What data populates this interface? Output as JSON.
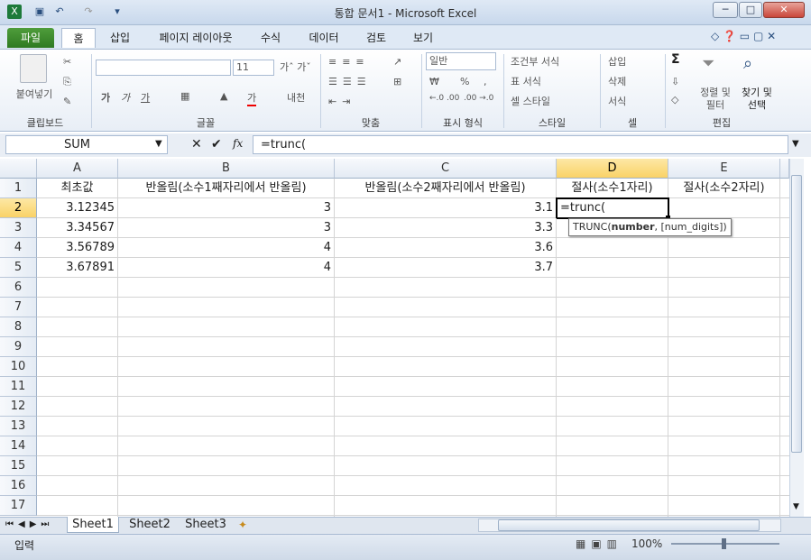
{
  "window": {
    "title": "통합 문서1 - Microsoft Excel",
    "minimize": "─",
    "maximize": "□",
    "close": "✕"
  },
  "quick_access": {
    "save_icon": "save-icon",
    "undo_icon": "undo-icon",
    "redo_icon": "redo-icon"
  },
  "tabs": [
    {
      "label": "파일"
    },
    {
      "label": "홈"
    },
    {
      "label": "삽입"
    },
    {
      "label": "페이지 레이아웃"
    },
    {
      "label": "수식"
    },
    {
      "label": "데이터"
    },
    {
      "label": "검토"
    },
    {
      "label": "보기"
    }
  ],
  "ribbon": {
    "clipboard": {
      "group_label": "클립보드",
      "paste_label": "붙여넣기"
    },
    "font": {
      "group_label": "글꼴",
      "font_size": "11",
      "bold": "가",
      "italic": "가",
      "underline": "가",
      "font_color": "가",
      "phonetic": "내천"
    },
    "alignment": {
      "group_label": "맞춤"
    },
    "number": {
      "group_label": "표시 형식",
      "format": "일반",
      "percent": "%",
      "comma": ",",
      "inc_dec": "←.0 .00",
      "dec_dec": ".00 →.0"
    },
    "styles": {
      "group_label": "스타일",
      "conditional": "조건부 서식",
      "table": "표 서식",
      "cell_style": "셀 스타일"
    },
    "cells": {
      "group_label": "셀",
      "insert": "삽입",
      "delete": "삭제",
      "format": "서식"
    },
    "editing": {
      "group_label": "편집",
      "sum": "Σ",
      "sort": "정렬 및 필터",
      "find": "찾기 및 선택"
    }
  },
  "formula_bar": {
    "name_box": "SUM",
    "fx": "fx",
    "cancel": "✕",
    "enter": "✔",
    "formula": "=trunc("
  },
  "columns": [
    "A",
    "B",
    "C",
    "D",
    "E"
  ],
  "rows": [
    "1",
    "2",
    "3",
    "4",
    "5",
    "6",
    "7",
    "8",
    "9",
    "10",
    "11",
    "12",
    "13",
    "14",
    "15",
    "16",
    "17"
  ],
  "cells": {
    "A1": "최초값",
    "B1": "반올림(소수1째자리에서 반올림)",
    "C1": "반올림(소수2째자리에서 반올림)",
    "D1": "절사(소수1자리)",
    "E1": "절사(소수2자리)",
    "A2": "3.12345",
    "B2": "3",
    "C2": "3.1",
    "D2": "=trunc(",
    "A3": "3.34567",
    "B3": "3",
    "C3": "3.3",
    "A4": "3.56789",
    "B4": "4",
    "C4": "3.6",
    "A5": "3.67891",
    "B5": "4",
    "C5": "3.7"
  },
  "tooltip": {
    "fn": "TRUNC(",
    "arg1": "number",
    "rest": ", [num_digits])"
  },
  "sheets": [
    {
      "label": "Sheet1"
    },
    {
      "label": "Sheet2"
    },
    {
      "label": "Sheet3"
    }
  ],
  "status": {
    "mode": "입력",
    "zoom": "100%"
  }
}
